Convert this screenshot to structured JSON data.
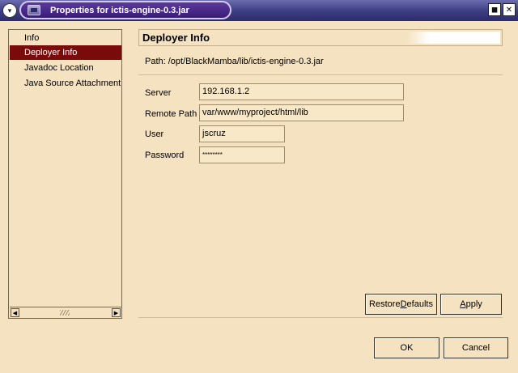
{
  "window": {
    "title": "Properties for ictis-engine-0.3.jar",
    "menu_glyph": "▾",
    "maximize_glyph": "◼",
    "close_glyph": "✕"
  },
  "nav": {
    "items": [
      {
        "label": "Info"
      },
      {
        "label": "Deployer Info"
      },
      {
        "label": "Javadoc Location"
      },
      {
        "label": "Java Source Attachment"
      }
    ],
    "selected": "Deployer Info",
    "scroll_left_glyph": "◀",
    "scroll_right_glyph": "▶"
  },
  "content": {
    "title": "Deployer Info",
    "path": "Path:  /opt/BlackMamba/lib/ictis-engine-0.3.jar",
    "fields": {
      "server_label": "Server",
      "server_value": "192.168.1.2",
      "remote_path_label": "Remote Path",
      "remote_path_value": "var/www/myproject/html/lib",
      "user_label": "User",
      "user_value": "jscruz",
      "password_label": "Password",
      "password_value": "********"
    }
  },
  "buttons": {
    "restore_defaults_pre": "Restore ",
    "restore_defaults_mnemonic": "D",
    "restore_defaults_post": "efaults",
    "apply_mnemonic": "A",
    "apply_post": "pply",
    "ok": "OK",
    "cancel": "Cancel"
  },
  "colors": {
    "background": "#f5e2c0",
    "selection": "#7a0b0b",
    "titlebar": "#3c3c82"
  }
}
